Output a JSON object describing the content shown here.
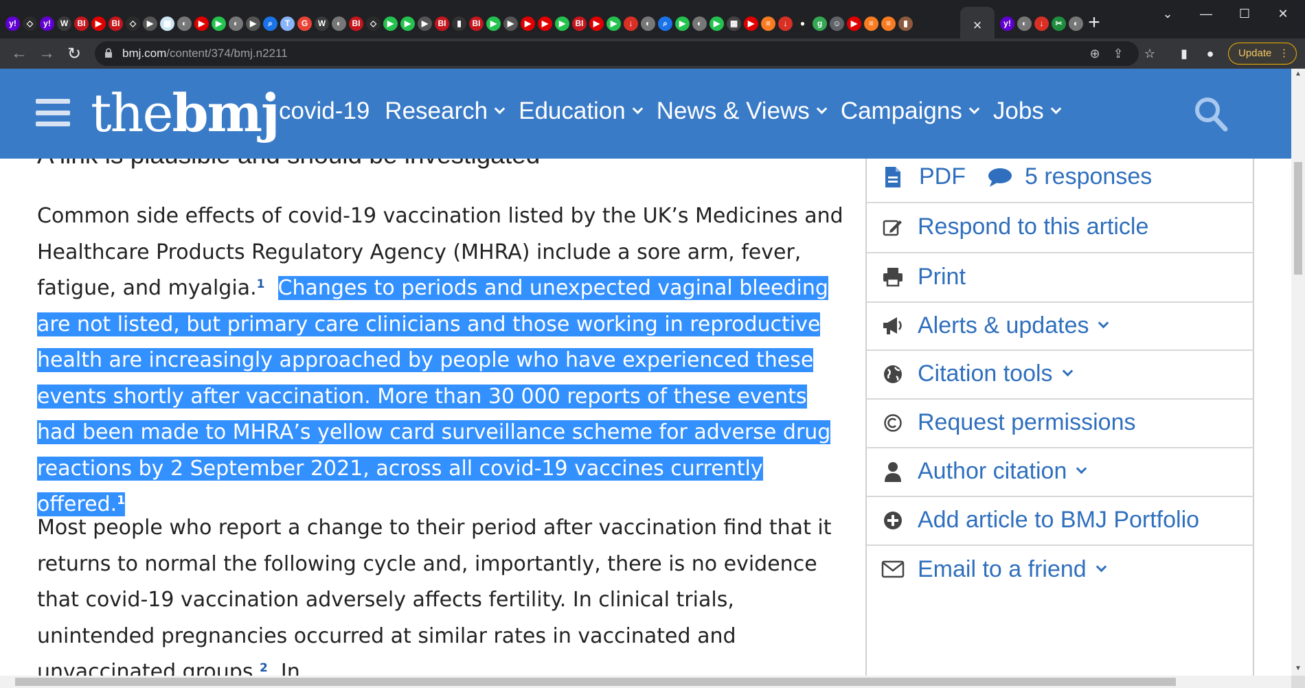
{
  "browser": {
    "url_host": "bmj.com",
    "url_path": "/content/374/bmj.n2211",
    "update_label": "Update",
    "new_tab_symbol": "+",
    "active_tab_close": "×",
    "tab_favicons": [
      {
        "label": "y!",
        "color": "#6001d2"
      },
      {
        "label": "◇",
        "color": "#2b2b2b"
      },
      {
        "label": "y!",
        "color": "#6001d2"
      },
      {
        "label": "W",
        "color": "#3a3a3a"
      },
      {
        "label": "BI",
        "color": "#c4161c"
      },
      {
        "label": "▶",
        "color": "#e00000"
      },
      {
        "label": "BI",
        "color": "#c4161c"
      },
      {
        "label": "◇",
        "color": "#2b2b2b"
      },
      {
        "label": "▶",
        "color": "#555"
      },
      {
        "label": "▦",
        "color": "#cfe7f3"
      },
      {
        "label": "◐",
        "color": "#777"
      },
      {
        "label": "▶",
        "color": "#e00000"
      },
      {
        "label": "▶",
        "color": "#24c24f"
      },
      {
        "label": "◐",
        "color": "#777"
      },
      {
        "label": "▶",
        "color": "#555"
      },
      {
        "label": "⌕",
        "color": "#1a73e8"
      },
      {
        "label": "T",
        "color": "#8ab4f8"
      },
      {
        "label": "G",
        "color": "#ea4335"
      },
      {
        "label": "W",
        "color": "#3a3a3a"
      },
      {
        "label": "◐",
        "color": "#777"
      },
      {
        "label": "BI",
        "color": "#c4161c"
      },
      {
        "label": "◇",
        "color": "#2b2b2b"
      },
      {
        "label": "▶",
        "color": "#24c24f"
      },
      {
        "label": "▶",
        "color": "#24c24f"
      },
      {
        "label": "▶",
        "color": "#555"
      },
      {
        "label": "BI",
        "color": "#c4161c"
      },
      {
        "label": "▮",
        "color": "#333"
      },
      {
        "label": "BI",
        "color": "#c4161c"
      },
      {
        "label": "▶",
        "color": "#24c24f"
      },
      {
        "label": "▶",
        "color": "#555"
      },
      {
        "label": "▶",
        "color": "#e00000"
      },
      {
        "label": "▶",
        "color": "#e00000"
      },
      {
        "label": "▶",
        "color": "#24c24f"
      },
      {
        "label": "BI",
        "color": "#c4161c"
      },
      {
        "label": "▶",
        "color": "#e00000"
      },
      {
        "label": "▶",
        "color": "#24c24f"
      },
      {
        "label": "↓",
        "color": "#d93025"
      },
      {
        "label": "◐",
        "color": "#777"
      },
      {
        "label": "⌕",
        "color": "#1a73e8"
      },
      {
        "label": "▶",
        "color": "#24c24f"
      },
      {
        "label": "◐",
        "color": "#777"
      },
      {
        "label": "▶",
        "color": "#24c24f"
      },
      {
        "label": "▦",
        "color": "#444"
      },
      {
        "label": "▶",
        "color": "#e00000"
      },
      {
        "label": "≡",
        "color": "#f97b22"
      },
      {
        "label": "↓",
        "color": "#d93025"
      },
      {
        "label": "●",
        "color": "#222"
      },
      {
        "label": "g",
        "color": "#34a853"
      },
      {
        "label": "☺",
        "color": "#5f6368"
      },
      {
        "label": "▶",
        "color": "#e00000"
      },
      {
        "label": "≡",
        "color": "#f97b22"
      },
      {
        "label": "≡",
        "color": "#f97b22"
      },
      {
        "label": "▮",
        "color": "#8c5b3e"
      }
    ],
    "tab_favicons_after": [
      {
        "label": "y!",
        "color": "#6001d2"
      },
      {
        "label": "◐",
        "color": "#777"
      },
      {
        "label": "↓",
        "color": "#d93025"
      },
      {
        "label": "✂",
        "color": "#1e8e3e"
      },
      {
        "label": "◐",
        "color": "#777"
      }
    ]
  },
  "site": {
    "logo_light": "the",
    "logo_bold": "bmj",
    "nav": [
      {
        "label": "covid-19",
        "caret": false
      },
      {
        "label": "Research",
        "caret": true
      },
      {
        "label": "Education",
        "caret": true
      },
      {
        "label": "News & Views",
        "caret": true
      },
      {
        "label": "Campaigns",
        "caret": true
      },
      {
        "label": "Jobs",
        "caret": true
      }
    ]
  },
  "article": {
    "clipped_heading": "A link is plausible and should be investigated",
    "para1_plain": "Common side effects of covid-19 vaccination listed by the UK’s Medicines and Healthcare Products Regulatory Agency (MHRA) include a sore arm, fever, fatigue, and myalgia.",
    "para1_ref": "1",
    "para1_highlighted": "Changes to periods and unexpected vaginal bleeding are not listed, but primary care clinicians and those working in reproductive health are increasingly approached by people who have experienced these events shortly after vaccination. More than 30 000 reports of these events had been made to MHRA’s yellow card surveillance scheme for adverse drug reactions by 2 September 2021, across all covid-19 vaccines currently offered.",
    "para1_highlighted_ref": "1",
    "para2_text": "Most people who report a change to their period after vaccination find that it returns to normal the following cycle and, importantly, there is no evidence that covid-19 vaccination adversely affects fertility. In clinical trials, unintended pregnancies occurred at similar rates in vaccinated and unvaccinated groups.",
    "para2_ref": "2",
    "para2_tail": "In"
  },
  "sidebar": {
    "pdf_label": "PDF",
    "responses_label": "5 responses",
    "items": [
      {
        "label": "Respond to this article",
        "icon": "edit-icon",
        "caret": false
      },
      {
        "label": "Print",
        "icon": "printer-icon",
        "caret": false
      },
      {
        "label": "Alerts & updates",
        "icon": "megaphone-icon",
        "caret": true
      },
      {
        "label": "Citation tools",
        "icon": "globe-icon",
        "caret": true
      },
      {
        "label": "Request permissions",
        "icon": "copyright-icon",
        "caret": false
      },
      {
        "label": "Author citation",
        "icon": "person-icon",
        "caret": true
      },
      {
        "label": "Add article to BMJ Portfolio",
        "icon": "plus-circle-icon",
        "caret": false
      },
      {
        "label": "Email to a friend",
        "icon": "envelope-icon",
        "caret": true
      }
    ]
  },
  "colors": {
    "header_blue": "#3a7bc8",
    "link_blue": "#2f6fbd",
    "selection": "#3390ff"
  }
}
